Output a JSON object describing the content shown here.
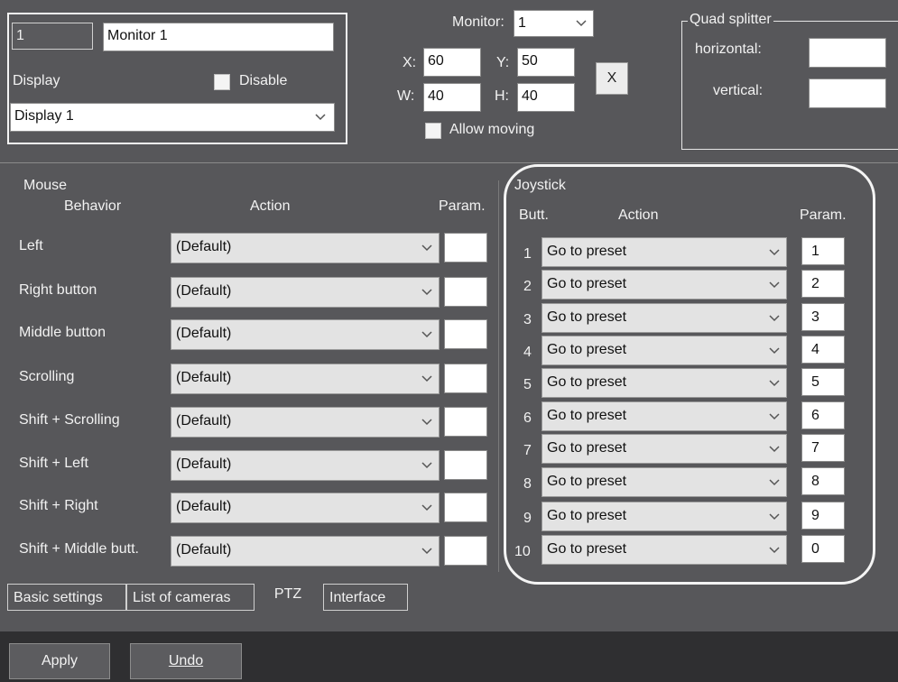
{
  "display_panel": {
    "monitor_id": "1",
    "monitor_name": "Monitor 1",
    "display_label": "Display",
    "disable_label": "Disable",
    "display_value": "Display 1"
  },
  "position_panel": {
    "monitor_label": "Monitor:",
    "monitor_value": "1",
    "x_label": "X:",
    "x_value": "60",
    "y_label": "Y:",
    "y_value": "50",
    "w_label": "W:",
    "w_value": "40",
    "h_label": "H:",
    "h_value": "40",
    "clear_label": "X",
    "allow_moving_label": "Allow moving"
  },
  "quad_splitter": {
    "title": "Quad splitter",
    "horizontal_label": "horizontal:",
    "vertical_label": "vertical:"
  },
  "mouse": {
    "title": "Mouse",
    "behavior_header": "Behavior",
    "action_header": "Action",
    "param_header": "Param.",
    "rows": [
      {
        "behavior": "Left",
        "action": "(Default)"
      },
      {
        "behavior": "Right button",
        "action": "(Default)"
      },
      {
        "behavior": "Middle button",
        "action": "(Default)"
      },
      {
        "behavior": "Scrolling",
        "action": "(Default)"
      },
      {
        "behavior": "Shift + Scrolling",
        "action": "(Default)"
      },
      {
        "behavior": "Shift + Left",
        "action": "(Default)"
      },
      {
        "behavior": "Shift + Right",
        "action": "(Default)"
      },
      {
        "behavior": "Shift + Middle butt.",
        "action": "(Default)"
      }
    ]
  },
  "joystick": {
    "title": "Joystick",
    "butt_header": "Butt.",
    "action_header": "Action",
    "param_header": "Param.",
    "rows": [
      {
        "butt": "1",
        "action": "Go to preset",
        "param": "1"
      },
      {
        "butt": "2",
        "action": "Go to preset",
        "param": "2"
      },
      {
        "butt": "3",
        "action": "Go to preset",
        "param": "3"
      },
      {
        "butt": "4",
        "action": "Go to preset",
        "param": "4"
      },
      {
        "butt": "5",
        "action": "Go to preset",
        "param": "5"
      },
      {
        "butt": "6",
        "action": "Go to preset",
        "param": "6"
      },
      {
        "butt": "7",
        "action": "Go to preset",
        "param": "7"
      },
      {
        "butt": "8",
        "action": "Go to preset",
        "param": "8"
      },
      {
        "butt": "9",
        "action": "Go to preset",
        "param": "9"
      },
      {
        "butt": "10",
        "action": "Go to preset",
        "param": "0"
      }
    ]
  },
  "tabs": [
    {
      "label": "Basic settings"
    },
    {
      "label": "List of cameras"
    },
    {
      "label": "PTZ"
    },
    {
      "label": "Interface"
    }
  ],
  "buttons": {
    "apply": "Apply",
    "undo": "Undo"
  },
  "colors": {
    "background": "#57575a",
    "bottom_bar": "#2f2f31",
    "highlight_ring": "#f4f4f4"
  }
}
